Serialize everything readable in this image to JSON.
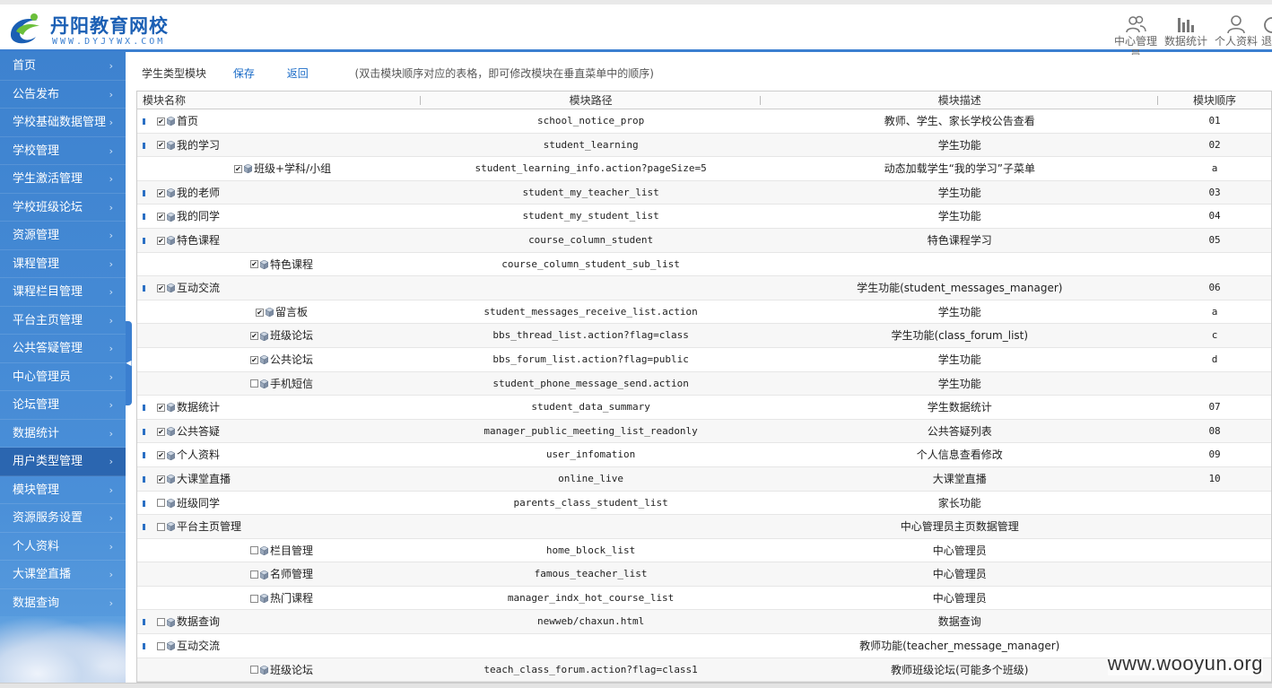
{
  "header": {
    "logo_title": "丹阳教育网校",
    "logo_sub": "WWW.DYJYWX.COM",
    "nav": [
      {
        "icon": "users-icon",
        "label": "中心管理员"
      },
      {
        "icon": "bar-chart-icon",
        "label": "数据统计"
      },
      {
        "icon": "user-icon",
        "label": "个人资料"
      },
      {
        "icon": "logout-icon",
        "label": "退"
      }
    ]
  },
  "sidebar": {
    "active": "用户类型管理",
    "items": [
      "首页",
      "公告发布",
      "学校基础数据管理",
      "学校管理",
      "学生激活管理",
      "学校班级论坛",
      "资源管理",
      "课程管理",
      "课程栏目管理",
      "平台主页管理",
      "公共答疑管理",
      "中心管理员",
      "论坛管理",
      "数据统计",
      "用户类型管理",
      "模块管理",
      "资源服务设置",
      "个人资料",
      "大课堂直播",
      "数据查询"
    ]
  },
  "toolbar": {
    "title": "学生类型模块",
    "save": "保存",
    "back": "返回",
    "hint": "(双击模块顺序对应的表格，即可修改模块在垂直菜单中的顺序)"
  },
  "table": {
    "headers": [
      "模块名称",
      "模块路径",
      "模块描述",
      "模块顺序"
    ],
    "rows": [
      {
        "level": 0,
        "checked": true,
        "name": "首页",
        "path": "school_notice_prop",
        "desc": "教师、学生、家长学校公告查看",
        "order": "01"
      },
      {
        "level": 0,
        "checked": true,
        "name": "我的学习",
        "path": "student_learning",
        "desc": "学生功能",
        "order": "02"
      },
      {
        "level": 3,
        "checked": true,
        "name": "班级+学科/小组",
        "path": "student_learning_info.action?pageSize=5",
        "desc": "动态加载学生“我的学习”子菜单",
        "order": "a"
      },
      {
        "level": 0,
        "checked": true,
        "name": "我的老师",
        "path": "student_my_teacher_list",
        "desc": "学生功能",
        "order": "03"
      },
      {
        "level": 0,
        "checked": true,
        "name": "我的同学",
        "path": "student_my_student_list",
        "desc": "学生功能",
        "order": "04"
      },
      {
        "level": 0,
        "checked": true,
        "name": "特色课程",
        "path": "course_column_student",
        "desc": "特色课程学习",
        "order": "05"
      },
      {
        "level": 4,
        "checked": true,
        "name": "特色课程",
        "path": "course_column_student_sub_list",
        "desc": "",
        "order": ""
      },
      {
        "level": 0,
        "checked": true,
        "name": "互动交流",
        "path": "",
        "desc": "学生功能(student_messages_manager)",
        "order": "06"
      },
      {
        "level": 5,
        "checked": true,
        "name": "留言板",
        "path": "student_messages_receive_list.action",
        "desc": "学生功能",
        "order": "a"
      },
      {
        "level": 4,
        "checked": true,
        "name": "班级论坛",
        "path": "bbs_thread_list.action?flag=class",
        "desc": "学生功能(class_forum_list)",
        "order": "c"
      },
      {
        "level": 4,
        "checked": true,
        "name": "公共论坛",
        "path": "bbs_forum_list.action?flag=public",
        "desc": "学生功能",
        "order": "d"
      },
      {
        "level": 4,
        "checked": false,
        "name": "手机短信",
        "path": "student_phone_message_send.action",
        "desc": "学生功能",
        "order": ""
      },
      {
        "level": 0,
        "checked": true,
        "name": "数据统计",
        "path": "student_data_summary",
        "desc": "学生数据统计",
        "order": "07"
      },
      {
        "level": 0,
        "checked": true,
        "name": "公共答疑",
        "path": "manager_public_meeting_list_readonly",
        "desc": "公共答疑列表",
        "order": "08"
      },
      {
        "level": 0,
        "checked": true,
        "name": "个人资料",
        "path": "user_infomation",
        "desc": "个人信息查看修改",
        "order": "09"
      },
      {
        "level": 0,
        "checked": true,
        "name": "大课堂直播",
        "path": "online_live",
        "desc": "大课堂直播",
        "order": "10"
      },
      {
        "level": 0,
        "checked": false,
        "name": "班级同学",
        "path": "parents_class_student_list",
        "desc": "家长功能",
        "order": ""
      },
      {
        "level": 0,
        "checked": false,
        "name": "平台主页管理",
        "path": "",
        "desc": "中心管理员主页数据管理",
        "order": ""
      },
      {
        "level": 4,
        "checked": false,
        "name": "栏目管理",
        "path": "home_block_list",
        "desc": "中心管理员",
        "order": ""
      },
      {
        "level": 4,
        "checked": false,
        "name": "名师管理",
        "path": "famous_teacher_list",
        "desc": "中心管理员",
        "order": ""
      },
      {
        "level": 4,
        "checked": false,
        "name": "热门课程",
        "path": "manager_indx_hot_course_list",
        "desc": "中心管理员",
        "order": ""
      },
      {
        "level": 0,
        "checked": false,
        "name": "数据查询",
        "path": "newweb/chaxun.html",
        "desc": "数据查询",
        "order": ""
      },
      {
        "level": 0,
        "checked": false,
        "name": "互动交流",
        "path": "",
        "desc": "教师功能(teacher_message_manager)",
        "order": ""
      },
      {
        "level": 4,
        "checked": false,
        "name": "班级论坛",
        "path": "teach_class_forum.action?flag=class1",
        "desc": "教师班级论坛(可能多个班级)",
        "order": ""
      }
    ]
  },
  "watermark": "www.wooyun.org",
  "colors": {
    "accent": "#3b7fd0",
    "sidebar": "#4a8fd8",
    "active": "#2b66b0",
    "link": "#1a6bc7"
  }
}
